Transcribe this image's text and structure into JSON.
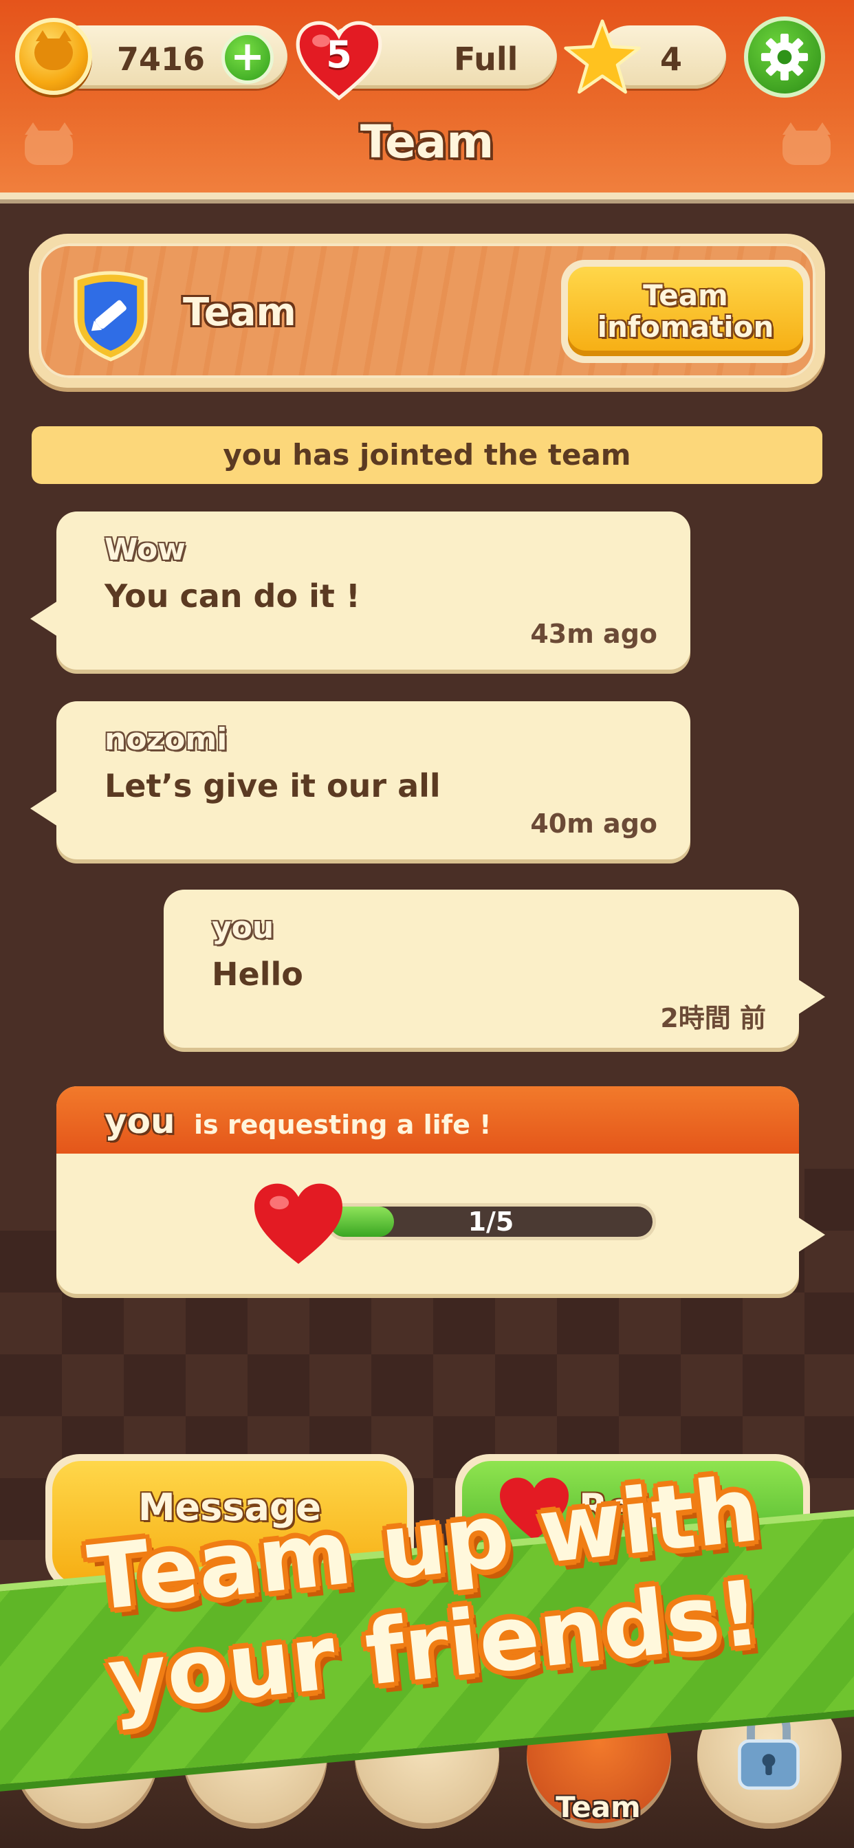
{
  "header": {
    "coins": "7416",
    "lives_count": "5",
    "lives_status": "Full",
    "stars": "4",
    "title": "Team"
  },
  "team": {
    "name": "Team",
    "info_button": "Team\ninfomation"
  },
  "notice": "you has jointed the team",
  "messages": [
    {
      "sender": "Wow",
      "text": "You can do it !",
      "time": "43m ago",
      "side": "left"
    },
    {
      "sender": "nozomi",
      "text": "Let’s give it  our all",
      "time": "40m ago",
      "side": "left"
    },
    {
      "sender": "you",
      "text": "Hello",
      "time": "2時間 前",
      "side": "right"
    }
  ],
  "life_request": {
    "sender": "you",
    "text": "is requesting a life !",
    "progress_label": "1/5",
    "progress_value": 0.2
  },
  "buttons": {
    "message": "Message",
    "request": "Req"
  },
  "nav": {
    "active_label": "Team"
  },
  "promo": {
    "line1": "Team up with",
    "line2": "your friends!"
  },
  "colors": {
    "header_orange": "#e5541b",
    "background_brown": "#4a2f26",
    "bubble_cream": "#fbefc8",
    "accent_yellow": "#f6ad12",
    "accent_green": "#3aa622"
  },
  "icons": [
    "coin-cat-icon",
    "plus-icon",
    "heart-icon",
    "star-icon",
    "gear-icon",
    "pencil-shield-icon",
    "lock-icon"
  ]
}
